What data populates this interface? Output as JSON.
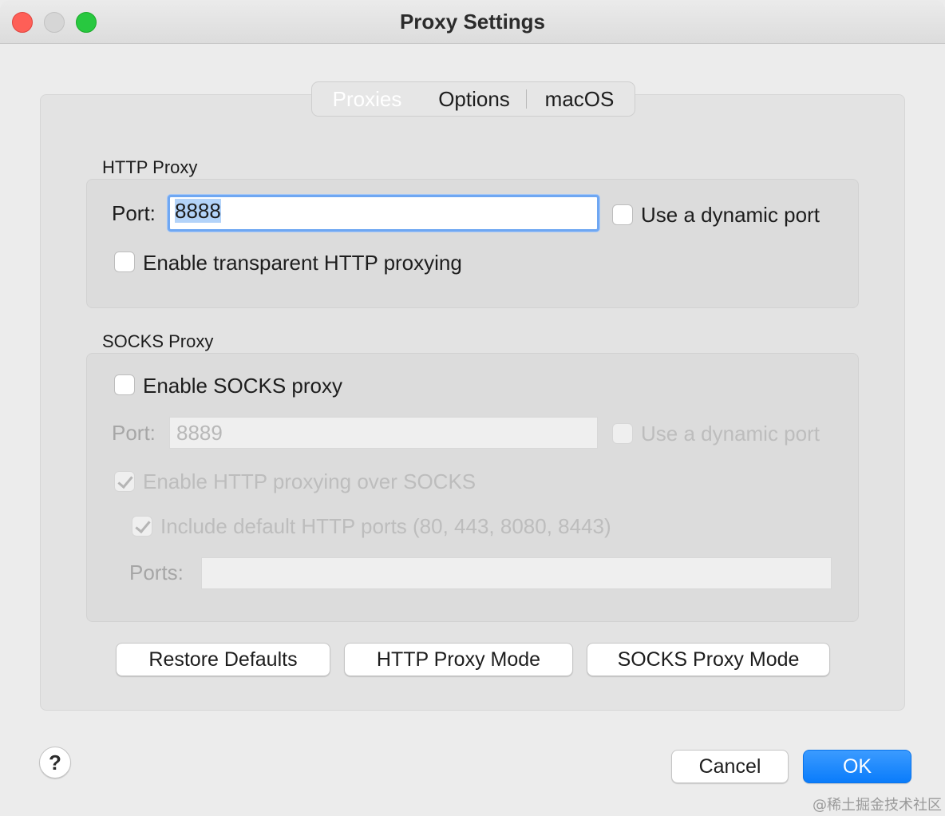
{
  "window": {
    "title": "Proxy Settings"
  },
  "tabs": [
    {
      "label": "Proxies",
      "active": true
    },
    {
      "label": "Options",
      "active": false
    },
    {
      "label": "macOS",
      "active": false
    }
  ],
  "http_proxy": {
    "section_label": "HTTP Proxy",
    "port_label": "Port:",
    "port_value": "8888",
    "dynamic_port_label": "Use a dynamic port",
    "dynamic_port_checked": false,
    "transparent_label": "Enable transparent HTTP proxying",
    "transparent_checked": false
  },
  "socks_proxy": {
    "section_label": "SOCKS Proxy",
    "enable_label": "Enable SOCKS proxy",
    "enable_checked": false,
    "port_label": "Port:",
    "port_value": "8889",
    "dynamic_port_label": "Use a dynamic port",
    "dynamic_port_checked": false,
    "http_over_socks_label": "Enable HTTP proxying over SOCKS",
    "http_over_socks_checked": true,
    "include_default_ports_label": "Include default HTTP ports (80, 443, 8080, 8443)",
    "include_default_ports_checked": true,
    "ports_label": "Ports:",
    "ports_value": ""
  },
  "buttons": {
    "restore_defaults": "Restore Defaults",
    "http_proxy_mode": "HTTP Proxy Mode",
    "socks_proxy_mode": "SOCKS Proxy Mode",
    "cancel": "Cancel",
    "ok": "OK",
    "help": "?"
  },
  "watermark": "@稀土掘金技术社区",
  "colors": {
    "accent": "#0a7cfb",
    "close": "#fe5f57",
    "zoom": "#28c840"
  }
}
